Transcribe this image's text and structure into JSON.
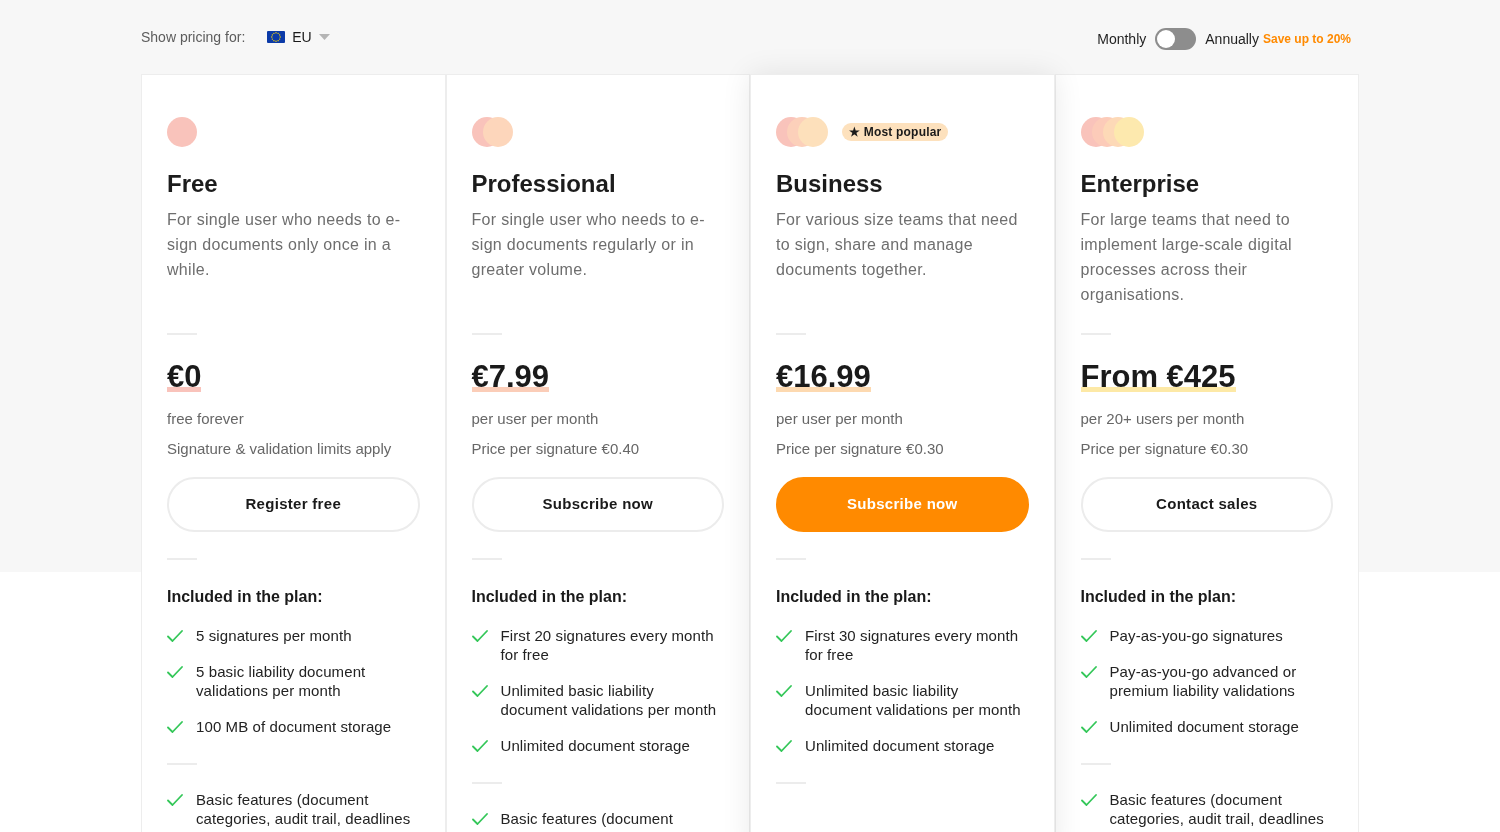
{
  "pricing_region": {
    "label": "Show pricing for:",
    "value": "EU"
  },
  "billing_toggle": {
    "left_label": "Monthly",
    "on": false,
    "right_label": "Annually",
    "note": "Save up to 20%"
  },
  "plans": [
    {
      "name": "Free",
      "featured": false,
      "icon_dots": [
        {
          "color": "#f9c3bb"
        }
      ],
      "description": "For single user who needs to e-sign documents only once in a while.",
      "price": "€0",
      "color": "#f9c3bb",
      "billing": "free forever",
      "signature_note": "Signature & validation limits apply",
      "button": "Register free",
      "features_heading": "Included in the plan:",
      "feature_groups": [
        [
          "5 signatures per month",
          "5 basic liability document validations per month",
          "100 MB of document storage"
        ],
        [
          "Basic features (document categories, audit trail, deadlines"
        ]
      ]
    },
    {
      "name": "Professional",
      "featured": false,
      "icon_dots": [
        {
          "color": "#f9c3bb"
        },
        {
          "color": "#fdd6bb"
        }
      ],
      "description": "For single user who needs to e-sign documents regularly or in greater volume.",
      "price": "€7.99",
      "color": "#fbcdb8",
      "billing": "per user per month",
      "signature_note": "Price per signature €0.40",
      "button": "Subscribe now",
      "features_heading": "Included in the plan:",
      "feature_groups": [
        [
          "First 20 signatures every month for free",
          "Unlimited basic liability document validations per month",
          "Unlimited document storage"
        ],
        [
          "Basic features (document"
        ]
      ]
    },
    {
      "name": "Business",
      "featured": true,
      "badge": "★ Most popular",
      "icon_dots": [
        {
          "color": "#f9c3bb"
        },
        {
          "color": "#fcd0ba"
        },
        {
          "color": "#fde0bb"
        }
      ],
      "description": "For various size teams that need to sign, share and manage documents together.",
      "price": "€16.99",
      "color": "#fdd9b0",
      "billing": "per user per month",
      "signature_note": "Price per signature €0.30",
      "button": "Subscribe now",
      "features_heading": "Included in the plan:",
      "feature_groups": [
        [
          "First 30 signatures every month for free",
          "Unlimited basic liability document validations per month",
          "Unlimited document storage"
        ]
      ]
    },
    {
      "name": "Enterprise",
      "featured": false,
      "icon_dots": [
        {
          "color": "#f9c3bb"
        },
        {
          "color": "#fccbb9"
        },
        {
          "color": "#fdd9b7"
        },
        {
          "color": "#fde9ae"
        }
      ],
      "description": "For large teams that need to implement large-scale digital processes across their organisations.",
      "price": "From €425",
      "color": "#fde9a6",
      "billing": "per 20+ users per month",
      "signature_note": "Price per signature €0.30",
      "button": "Contact sales",
      "features_heading": "Included in the plan:",
      "feature_groups": [
        [
          "Pay-as-you-go signatures",
          "Pay-as-you-go advanced or premium liability validations",
          "Unlimited document storage"
        ],
        [
          "Basic features (document categories, audit trail, deadlines"
        ]
      ]
    }
  ]
}
